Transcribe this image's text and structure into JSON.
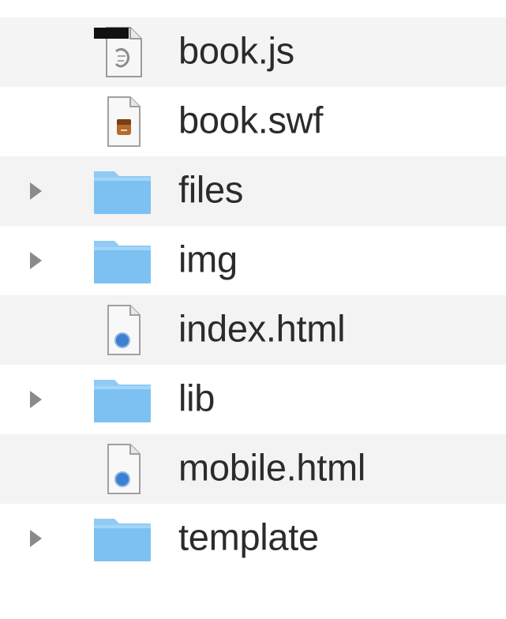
{
  "file_list": {
    "items": [
      {
        "name": "book.js",
        "kind": "script",
        "icon": "js-script-file-icon",
        "expandable": false
      },
      {
        "name": "book.swf",
        "kind": "flash",
        "icon": "swf-file-icon",
        "expandable": false
      },
      {
        "name": "files",
        "kind": "folder",
        "icon": "folder-icon",
        "expandable": true
      },
      {
        "name": "img",
        "kind": "folder",
        "icon": "folder-icon",
        "expandable": true
      },
      {
        "name": "index.html",
        "kind": "html",
        "icon": "html-file-icon",
        "expandable": false
      },
      {
        "name": "lib",
        "kind": "folder",
        "icon": "folder-icon",
        "expandable": true
      },
      {
        "name": "mobile.html",
        "kind": "html",
        "icon": "html-file-icon",
        "expandable": false
      },
      {
        "name": "template",
        "kind": "folder",
        "icon": "folder-icon",
        "expandable": true
      }
    ]
  },
  "colors": {
    "folder_fill": "#7cc1f2",
    "folder_tab": "#8fcbf5",
    "html_badge": "#3d7fd0",
    "stripe": "#f3f3f3",
    "disclosure": "#8a8a8a",
    "text": "#2b2b2b"
  }
}
